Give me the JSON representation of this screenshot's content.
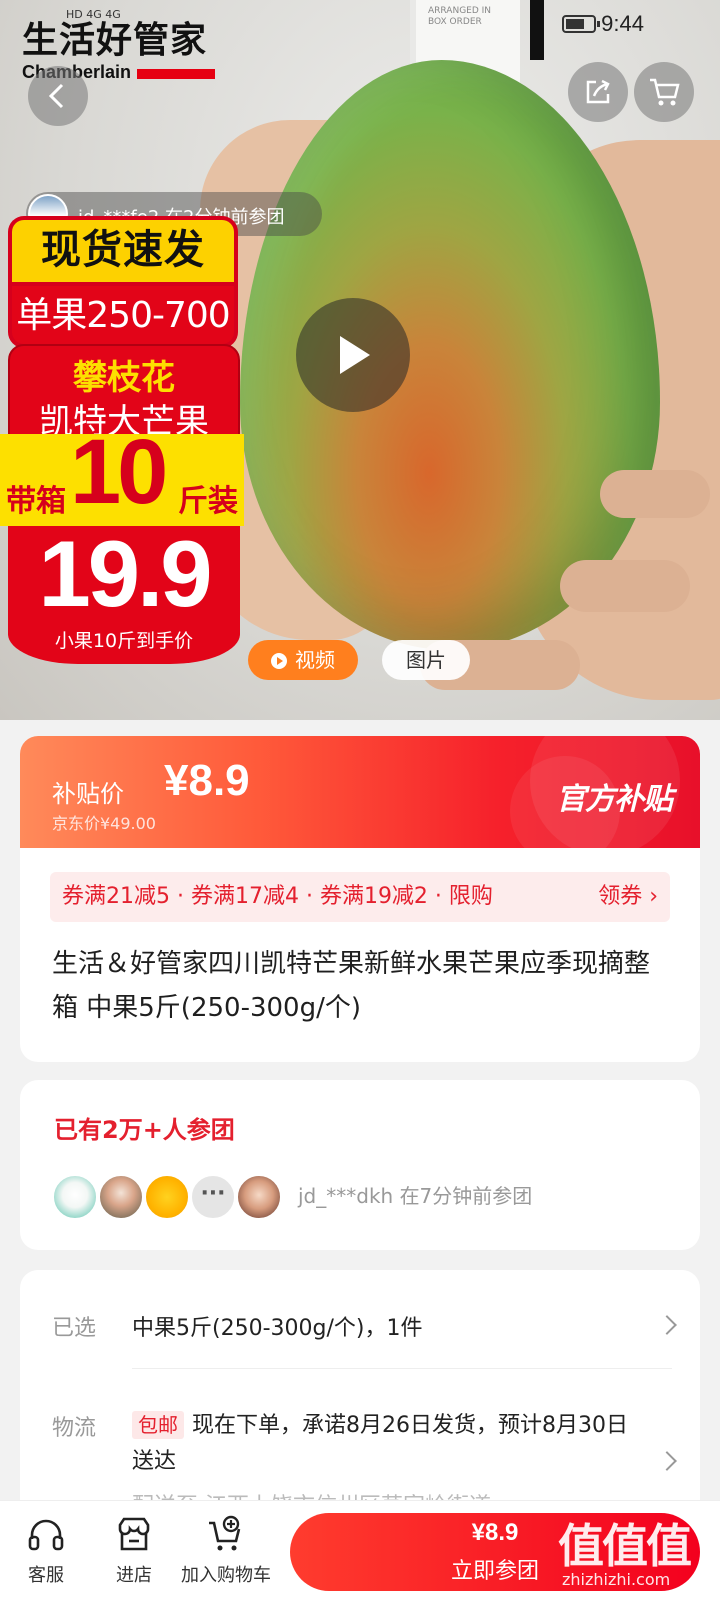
{
  "status_bar": {
    "time": "9:44",
    "signal_text": "HD 4G 4G"
  },
  "brand_logo": {
    "cn": "生活好管家",
    "en": "Chamberlain"
  },
  "hero": {
    "shirt_tag_text": "ARRANGED IN BOX ORDER",
    "participant_toast": "jd_***fe2  在2分钟前参团",
    "promo": {
      "line1": "现货速发",
      "line2": "单果250-700",
      "line3": "攀枝花",
      "line4": "凯特大芒果",
      "line5_pre": "带箱",
      "line5_num": "10",
      "line5_post": "斤装",
      "price": "19.9",
      "caption": "小果10斤到手价"
    },
    "media_tabs": {
      "video": "视频",
      "image": "图片"
    }
  },
  "price_banner": {
    "subsidy_label": "补贴价",
    "subsidy_price": "¥8.9",
    "jd_price": "京东价¥49.00",
    "official_tag": "官方补贴"
  },
  "coupons": {
    "text": "券满21减5 · 券满17减4 · 券满19减2 · 限购",
    "action": "领券 ›"
  },
  "product": {
    "title": "生活＆好管家四川凯特芒果新鲜水果芒果应季现摘整箱 中果5斤(250-300g/个)"
  },
  "group": {
    "count_text": "已有2万+人参团",
    "more_avatars": "···",
    "recent": "jd_***dkh 在7分钟前参团"
  },
  "spec": {
    "selected_label": "已选",
    "selected_value": "中果5斤(250-300g/个)，1件",
    "logistics_label": "物流",
    "free_shipping": "包邮",
    "logistics_value": "现在下单，承诺8月26日发货，预计8月30日送达",
    "address_peek": "配送至  江西上饶市信州区茅家岭街道"
  },
  "bottom_bar": {
    "service": "客服",
    "store": "进店",
    "add_cart": "加入购物车",
    "join_price": "¥8.9",
    "join_label": "立即参团"
  },
  "watermark": {
    "cn": "值值值",
    "en": "zhizhizhi.com"
  },
  "colors": {
    "accent_red": "#e4202e",
    "orange": "#ff7f1e",
    "promo_yellow": "#fde000"
  }
}
